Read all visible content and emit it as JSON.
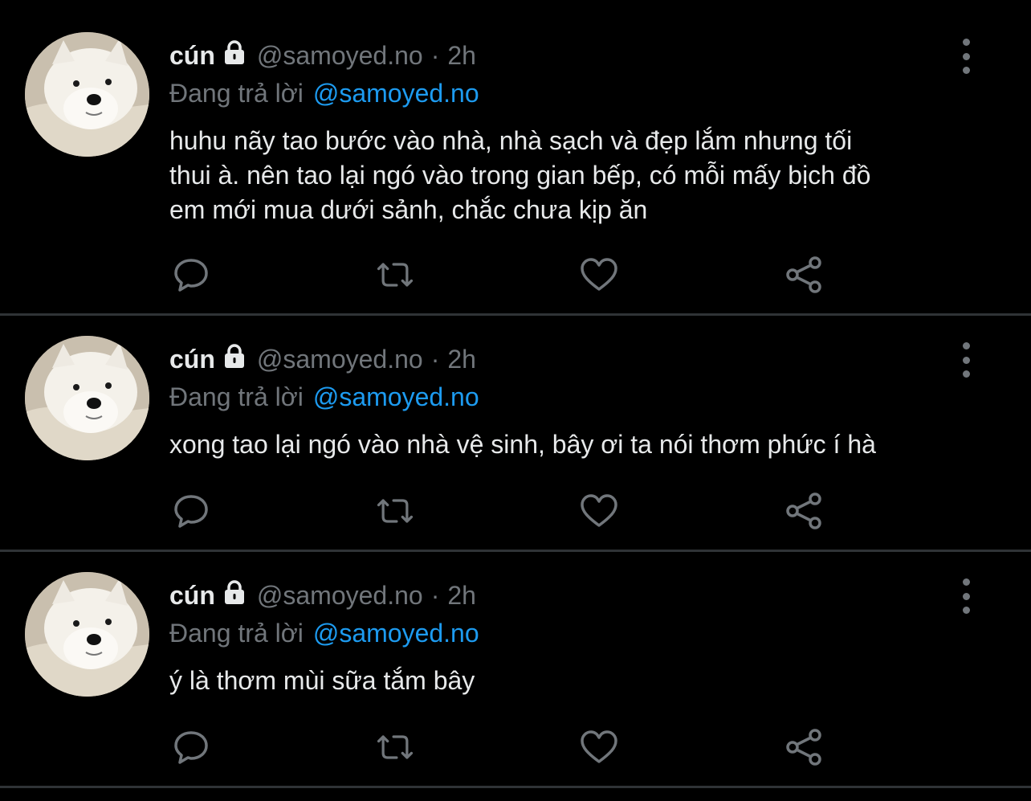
{
  "colors": {
    "background": "#000000",
    "text": "#e7e9ea",
    "muted": "#71767b",
    "link": "#1d9bf0",
    "divider": "#2f3336"
  },
  "icons": {
    "lock": "lock-icon",
    "more": "more-vertical-icon",
    "reply": "reply-icon",
    "retweet": "retweet-icon",
    "like": "heart-icon",
    "share": "share-icon"
  },
  "tweets": [
    {
      "name": "cún",
      "handle": "@samoyed.no",
      "separator": "·",
      "time": "2h",
      "reply_label": "Đang trả lời",
      "reply_handle": "@samoyed.no",
      "lines": [
        "huhu nãy tao bước vào nhà, nhà sạch và đẹp lắm nhưng tối",
        "thui à. nên tao lại ngó vào trong gian bếp, có mỗi mấy bịch đồ",
        "em mới mua dưới sảnh, chắc chưa kịp ăn"
      ]
    },
    {
      "name": "cún",
      "handle": "@samoyed.no",
      "separator": "·",
      "time": "2h",
      "reply_label": "Đang trả lời",
      "reply_handle": "@samoyed.no",
      "lines": [
        "xong tao lại ngó vào nhà vệ sinh, bây ơi ta nói thơm phức í hà"
      ]
    },
    {
      "name": "cún",
      "handle": "@samoyed.no",
      "separator": "·",
      "time": "2h",
      "reply_label": "Đang trả lời",
      "reply_handle": "@samoyed.no",
      "lines": [
        "ý là thơm mùi sữa tắm bây"
      ]
    }
  ]
}
